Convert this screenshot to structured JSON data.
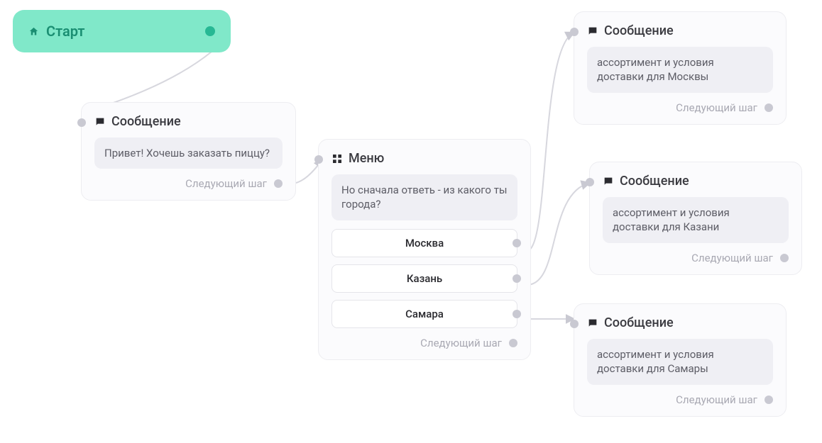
{
  "start": {
    "label": "Старт"
  },
  "msg1": {
    "title": "Сообщение",
    "text": "Привет! Хочешь заказать пиццу?",
    "next": "Следующий шаг"
  },
  "menu": {
    "title": "Меню",
    "prompt": "Но сначала ответь - из какого ты города?",
    "options": {
      "0": "Москва",
      "1": "Казань",
      "2": "Самара"
    },
    "next": "Следующий шаг"
  },
  "out_moscow": {
    "title": "Сообщение",
    "text": "ассортимент и условия доставки для Москвы",
    "next": "Следующий шаг"
  },
  "out_kazan": {
    "title": "Сообщение",
    "text": "ассортимент и условия доставки для Казани",
    "next": "Следующий шаг"
  },
  "out_samara": {
    "title": "Сообщение",
    "text": "ассортимент и условия доставки для Самары",
    "next": "Следующий шаг"
  }
}
